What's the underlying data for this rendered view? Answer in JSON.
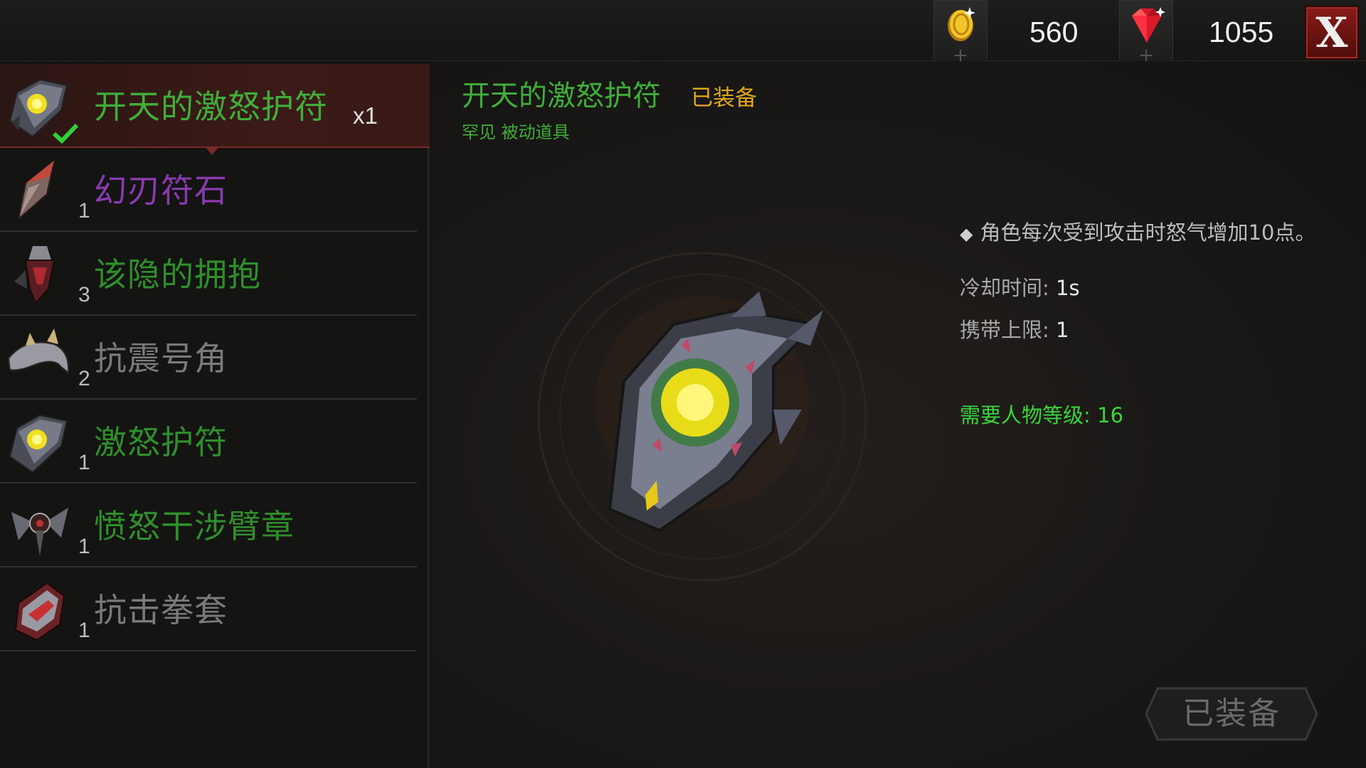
{
  "topbar": {
    "gold": {
      "icon": "gold-coin-icon",
      "value": "560"
    },
    "gems": {
      "icon": "ruby-gem-icon",
      "value": "1055"
    },
    "close_label": "X"
  },
  "items": [
    {
      "name": "开天的激怒护符",
      "count": "x1",
      "color": "#3fae3a",
      "selected": true,
      "equipped": true,
      "icon": "rage-amulet-icon"
    },
    {
      "name": "幻刃符石",
      "count": "1",
      "color": "#8a3ab0",
      "icon": "blade-runestone-icon"
    },
    {
      "name": "该隐的拥抱",
      "count": "3",
      "color": "#2f8f2a",
      "icon": "cains-embrace-icon"
    },
    {
      "name": "抗震号角",
      "count": "2",
      "color": "#7a7a7a",
      "icon": "horn-icon"
    },
    {
      "name": "激怒护符",
      "count": "1",
      "color": "#2f8f2a",
      "icon": "rage-amulet-icon"
    },
    {
      "name": "愤怒干涉臂章",
      "count": "1",
      "color": "#2f8f2a",
      "icon": "armband-icon"
    },
    {
      "name": "抗击拳套",
      "count": "1",
      "color": "#7a7a7a",
      "icon": "gauntlet-icon"
    }
  ],
  "detail": {
    "title": "开天的激怒护符",
    "equipped_tag": "已装备",
    "subtitle": "罕见  被动道具",
    "effect": "角色每次受到攻击时怒气增加10点。",
    "cooldown_label": "冷却时间: ",
    "cooldown_value": "1s",
    "carry_label": "携带上限: ",
    "carry_value": "1",
    "requirement": "需要人物等级: 16",
    "button_label": "已装备"
  }
}
